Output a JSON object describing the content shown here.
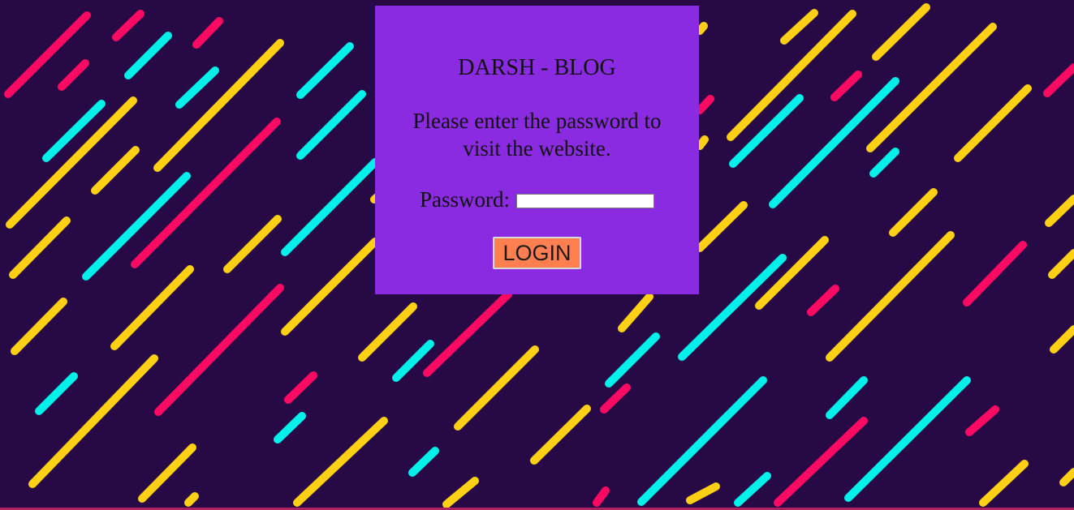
{
  "login": {
    "title": "DARSH - BLOG",
    "prompt": "Please enter the password to visit the website.",
    "password_label": "Password:",
    "password_value": "",
    "button_label": "LOGIN"
  },
  "colors": {
    "background": "#270a45",
    "panel": "#8a2be2",
    "button": "#ff7f50",
    "stripe_yellow": "#ffd014",
    "stripe_cyan": "#00f0ea",
    "stripe_pink": "#ff0a62"
  }
}
